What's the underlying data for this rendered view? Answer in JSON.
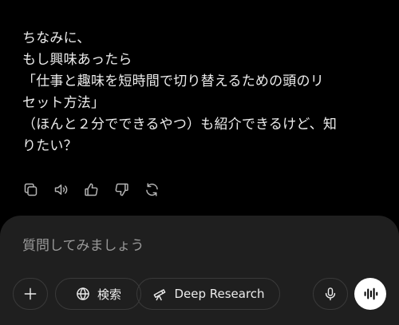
{
  "message": {
    "lines": [
      "ちなみに、",
      "もし興味あったら",
      "「仕事と趣味を短時間で切り替えるための頭のリ",
      "セット方法」",
      "（ほんと２分でできるやつ）も紹介できるけど、知",
      "りたい？"
    ]
  },
  "actions": [
    {
      "icon": "copy-icon"
    },
    {
      "icon": "speaker-icon"
    },
    {
      "icon": "thumbs-up-icon"
    },
    {
      "icon": "thumbs-down-icon"
    },
    {
      "icon": "regenerate-icon"
    }
  ],
  "composer": {
    "placeholder": "質問してみましょう",
    "search_label": "検索",
    "deep_research_label": "Deep Research",
    "voice_button_color": "#ffffff"
  },
  "colors": {
    "background": "#000000",
    "composer_background": "#1f1f1f",
    "text": "#ececec",
    "icon": "#b4b4b4"
  }
}
